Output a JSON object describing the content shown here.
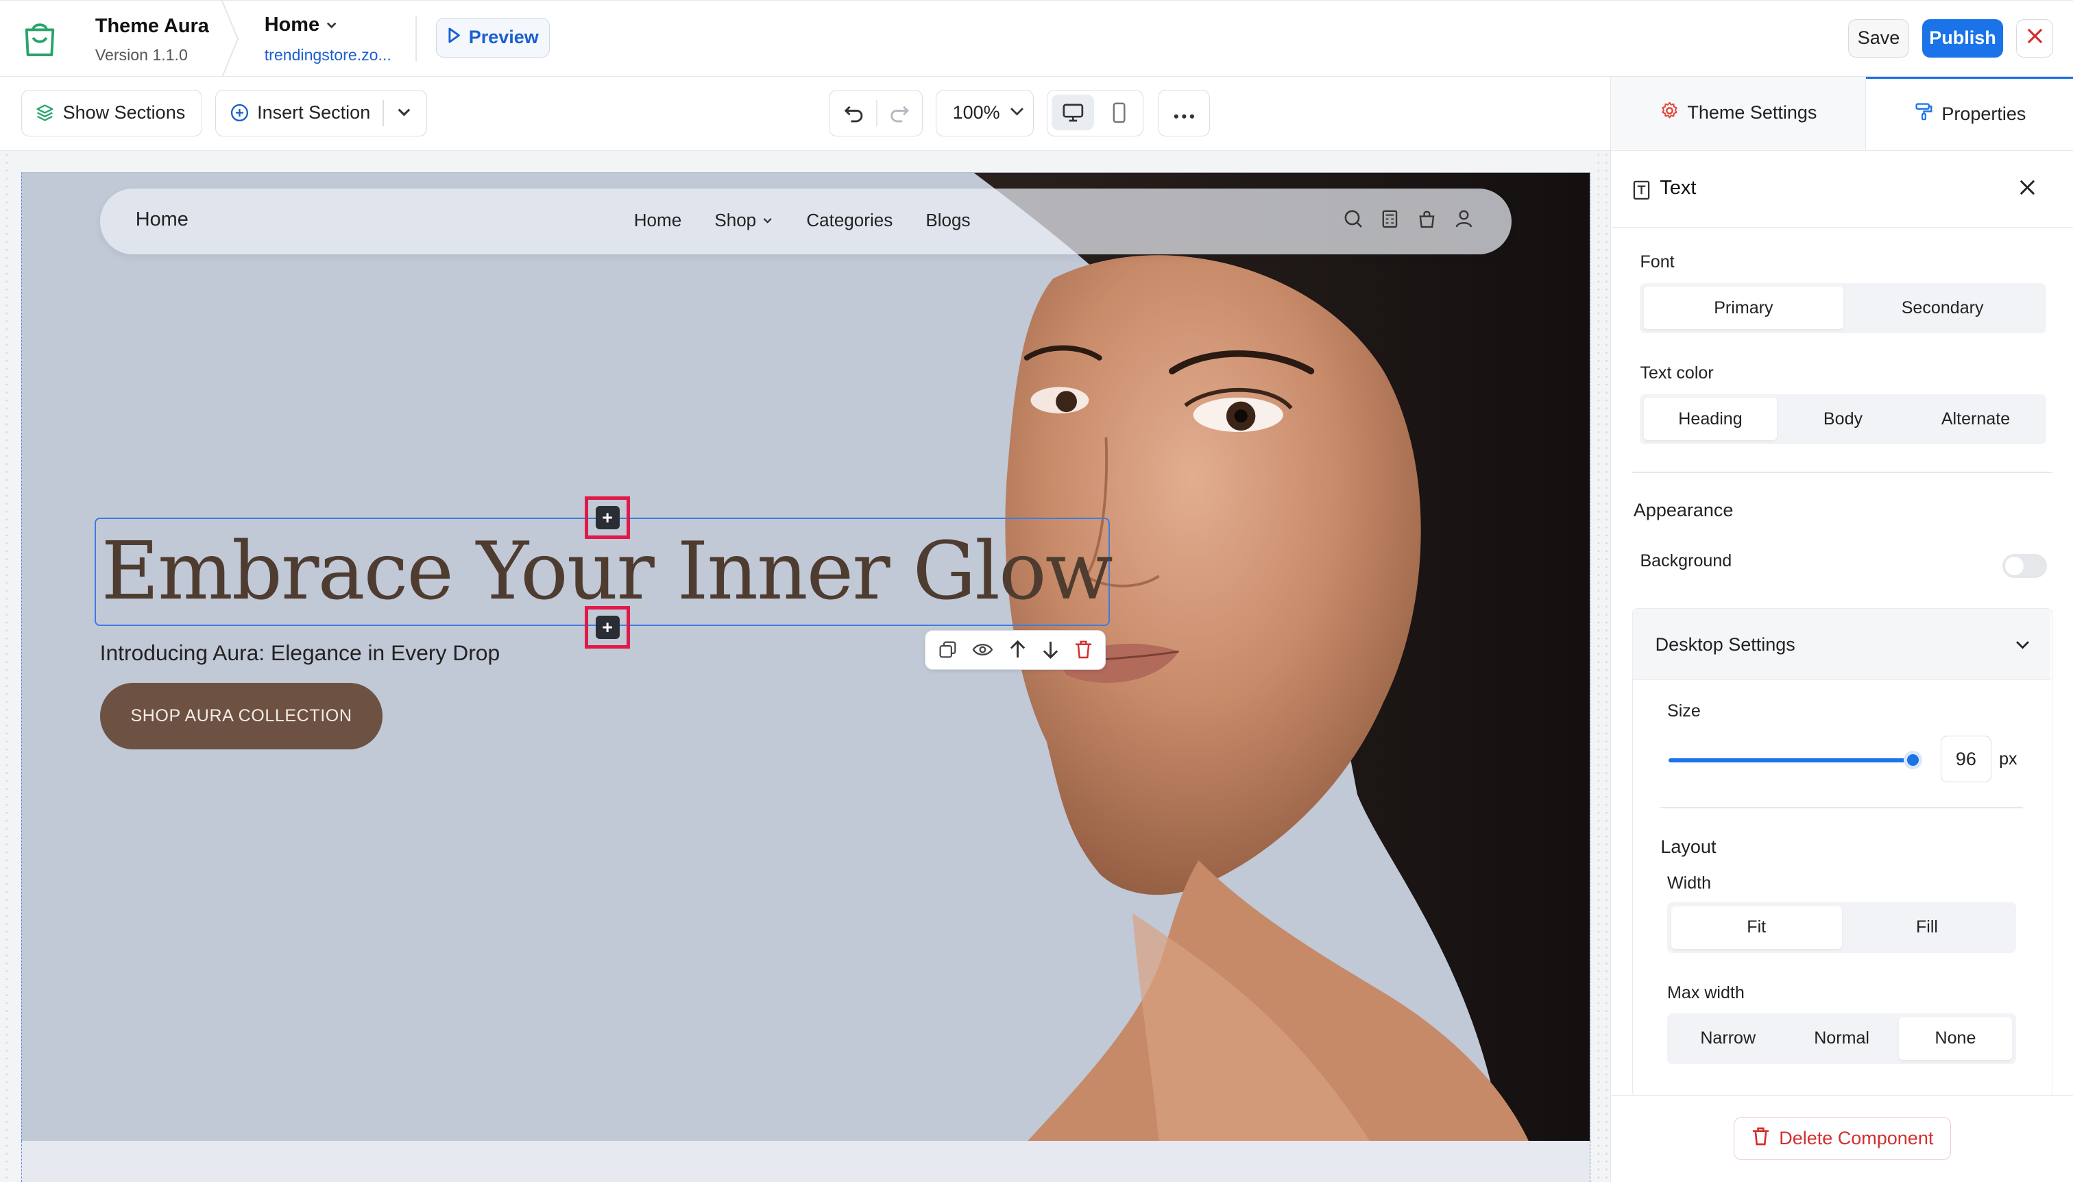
{
  "header": {
    "theme_name": "Theme Aura",
    "theme_version": "Version 1.1.0",
    "page_name": "Home",
    "page_url": "trendingstore.zo...",
    "preview_label": "Preview",
    "save_label": "Save",
    "publish_label": "Publish"
  },
  "toolbar": {
    "show_sections_label": "Show Sections",
    "insert_section_label": "Insert Section",
    "zoom_value": "100%"
  },
  "storefront": {
    "nav_brand": "Home",
    "nav_links": [
      "Home",
      "Shop",
      "Categories",
      "Blogs"
    ],
    "hero_title": "Embrace Your Inner Glow",
    "hero_subtitle": "Introducing Aura: Elegance in Every Drop",
    "hero_cta": "SHOP AURA COLLECTION"
  },
  "panel": {
    "tabs": {
      "theme_settings": "Theme Settings",
      "properties": "Properties"
    },
    "component_title": "Text",
    "font_label": "Font",
    "font_options": [
      "Primary",
      "Secondary"
    ],
    "font_selected": "Primary",
    "text_color_label": "Text color",
    "text_color_options": [
      "Heading",
      "Body",
      "Alternate"
    ],
    "text_color_selected": "Heading",
    "appearance_label": "Appearance",
    "background_label": "Background",
    "background_enabled": false,
    "desktop_settings_label": "Desktop Settings",
    "size_label": "Size",
    "size_value": "96",
    "size_unit": "px",
    "layout_label": "Layout",
    "width_label": "Width",
    "width_options": [
      "Fit",
      "Fill"
    ],
    "width_selected": "Fit",
    "max_width_label": "Max width",
    "max_width_options": [
      "Narrow",
      "Normal",
      "None"
    ],
    "max_width_selected": "None",
    "delete_label": "Delete Component"
  },
  "colors": {
    "accent": "#1a73e8",
    "danger": "#d32f2f",
    "hero_bg": "#c1c8d6",
    "cta_bg": "#6d5244",
    "title_color": "#4f3c30",
    "selection_marker": "#e0194a"
  }
}
